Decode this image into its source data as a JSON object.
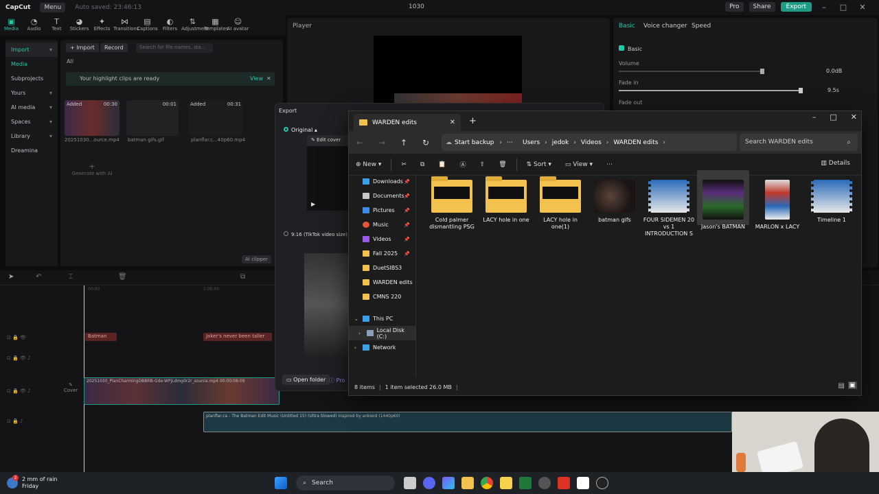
{
  "capcut": {
    "logo": "CapCut",
    "menu": "Menu",
    "autosave": "Auto saved: 23:46:13",
    "project_title": "1030",
    "pro": "Pro",
    "share": "Share",
    "export": "Export",
    "tools": [
      "Media",
      "Audio",
      "Text",
      "Stickers",
      "Effects",
      "Transitions",
      "Captions",
      "Filters",
      "Adjustment",
      "Templates",
      "AI avatar"
    ],
    "left_nav": [
      "Import",
      "Media",
      "Subprojects",
      "Yours",
      "AI media",
      "Spaces",
      "Library",
      "Dreamina"
    ],
    "media_import": "Import",
    "media_record": "Record",
    "media_search_placeholder": "Search for file names, sta...",
    "media_all": "All",
    "highlight_banner": "Your highlight clips are ready",
    "highlight_view": "View",
    "clips": [
      {
        "badge": "Added",
        "duration": "00:30",
        "name": "20251030...ource.mp4"
      },
      {
        "badge": "",
        "duration": "00:01",
        "name": "batman gifs.gif"
      },
      {
        "badge": "Added",
        "duration": "00:31",
        "name": "planflar.c...40p60.mp4"
      }
    ],
    "generate_ai": "Generate with AI",
    "player": "Player",
    "right_tabs": [
      "Basic",
      "Voice changer",
      "Speed"
    ],
    "basic_label": "Basic",
    "volume_label": "Volume",
    "volume_value": "0.0dB",
    "fadein_label": "Fade in",
    "fadein_value": "9.5s",
    "fadeout_label": "Fade out",
    "ai_clipper": "AI clipper",
    "timeline": {
      "time0": "00:00",
      "time1": "1:00:00",
      "clip_batman": "Batman",
      "clip_joker": "Joker's never been taller",
      "video_clip": "20251030_PlanCharmingDBBRB-Gde-WPjLdmg0r2r_source.mp4   00:00:08:09",
      "cover": "Cover",
      "audio_clip": "planflar.ca - The Batman Edit Music (Untitled 15) (Ultra Slowed) inspired by ankieid (1440p60)"
    }
  },
  "export_dialog": {
    "title": "Export",
    "original": "Original",
    "edit_cover": "Edit cover",
    "tiktok": "9:16 (TikTok video size)",
    "open_folder": "Open folder",
    "pro": "Pro"
  },
  "explorer": {
    "tab_title": "WARDEN edits",
    "start_backup": "Start backup",
    "breadcrumbs": [
      "Users",
      "jedok",
      "Videos",
      "WARDEN edits"
    ],
    "search_placeholder": "Search WARDEN edits",
    "cmd": {
      "new": "New",
      "sort": "Sort",
      "view": "View",
      "details": "Details"
    },
    "sidebar": [
      {
        "label": "Downloads",
        "color": "#3aa0e8",
        "pin": true
      },
      {
        "label": "Documents",
        "color": "#c8c8c8",
        "pin": true
      },
      {
        "label": "Pictures",
        "color": "#3a8ee8",
        "pin": true
      },
      {
        "label": "Music",
        "color": "#e8563a",
        "pin": true
      },
      {
        "label": "Videos",
        "color": "#9a5ce8",
        "pin": true
      },
      {
        "label": "Fall 2025",
        "color": "#f2c14e",
        "pin": true
      },
      {
        "label": "DuetSIBS3",
        "color": "#f2c14e",
        "pin": false
      },
      {
        "label": "WARDEN edits",
        "color": "#f2c14e",
        "pin": false
      },
      {
        "label": "CMNS 220",
        "color": "#f2c14e",
        "pin": false
      }
    ],
    "this_pc": "This PC",
    "local_disk": "Local Disk (C:)",
    "network": "Network",
    "files": [
      {
        "name": "Cold palmer dismantling PSG",
        "kind": "folder"
      },
      {
        "name": "LACY hole in one",
        "kind": "folder"
      },
      {
        "name": "LACY hole in one(1)",
        "kind": "folder"
      },
      {
        "name": "batman gifs",
        "kind": "gif"
      },
      {
        "name": "FOUR SIDEMEN 20 vs 1 INTRODUCTION S",
        "kind": "video"
      },
      {
        "name": "Jason's BATMAN",
        "kind": "video"
      },
      {
        "name": "MARLON x LACY",
        "kind": "video"
      },
      {
        "name": "Timeline 1",
        "kind": "video"
      }
    ],
    "status_items": "8 items",
    "status_selected": "1 item selected  26.0 MB"
  },
  "taskbar": {
    "weather_line1": "2 mm of rain",
    "weather_line2": "Friday",
    "search": "Search"
  }
}
